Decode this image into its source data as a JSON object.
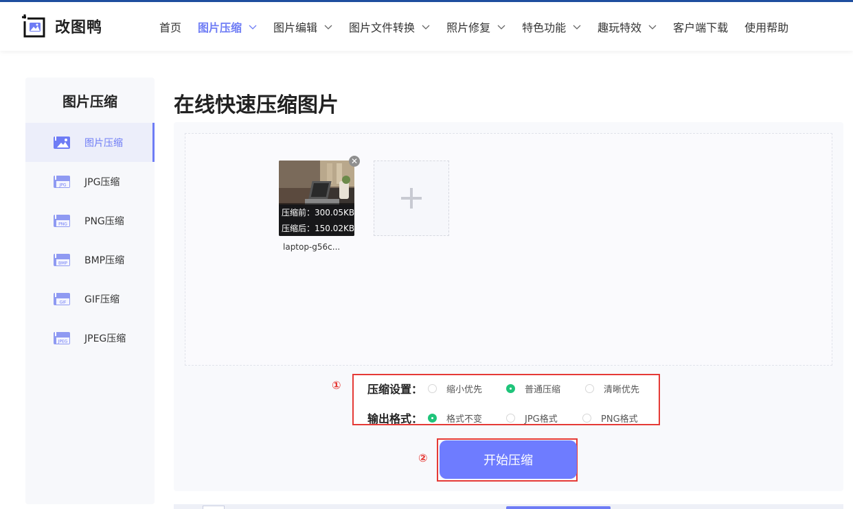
{
  "brand": {
    "name": "改图鸭",
    "accent": "#6e7cf5",
    "alert": "#e53935",
    "success": "#1fc47a"
  },
  "nav": {
    "items": [
      {
        "label": "首页",
        "dropdown": false,
        "active": false
      },
      {
        "label": "图片压缩",
        "dropdown": true,
        "active": true
      },
      {
        "label": "图片编辑",
        "dropdown": true,
        "active": false
      },
      {
        "label": "图片文件转换",
        "dropdown": true,
        "active": false
      },
      {
        "label": "照片修复",
        "dropdown": true,
        "active": false
      },
      {
        "label": "特色功能",
        "dropdown": true,
        "active": false
      },
      {
        "label": "趣玩特效",
        "dropdown": true,
        "active": false
      },
      {
        "label": "客户端下载",
        "dropdown": false,
        "active": false
      },
      {
        "label": "使用帮助",
        "dropdown": false,
        "active": false
      }
    ]
  },
  "sidebar": {
    "title": "图片压缩",
    "items": [
      {
        "label": "图片压缩",
        "icon": "image-icon",
        "badge": "",
        "active": true
      },
      {
        "label": "JPG压缩",
        "icon": "jpg-file-icon",
        "badge": "JPG",
        "active": false
      },
      {
        "label": "PNG压缩",
        "icon": "png-file-icon",
        "badge": "PNG",
        "active": false
      },
      {
        "label": "BMP压缩",
        "icon": "bmp-file-icon",
        "badge": "BMP",
        "active": false
      },
      {
        "label": "GIF压缩",
        "icon": "gif-file-icon",
        "badge": "GIF",
        "active": false
      },
      {
        "label": "JPEG压缩",
        "icon": "jpeg-file-icon",
        "badge": "JPEG",
        "active": false
      }
    ]
  },
  "main": {
    "title": "在线快速压缩图片",
    "file": {
      "name": "laptop-g56c...",
      "before": "压缩前：300.05KB",
      "after": "压缩后：150.02KB",
      "remove_icon": "close-icon"
    },
    "add_icon": "plus-icon",
    "settings": {
      "badge": "①",
      "compression": {
        "label": "压缩设置：",
        "options": [
          "缩小优先",
          "普通压缩",
          "清晰优先"
        ],
        "selected": "普通压缩"
      },
      "format": {
        "label": "输出格式：",
        "options": [
          "格式不变",
          "JPG格式",
          "PNG格式"
        ],
        "selected": "格式不变"
      }
    },
    "start": {
      "badge": "②",
      "label": "开始压缩"
    }
  }
}
